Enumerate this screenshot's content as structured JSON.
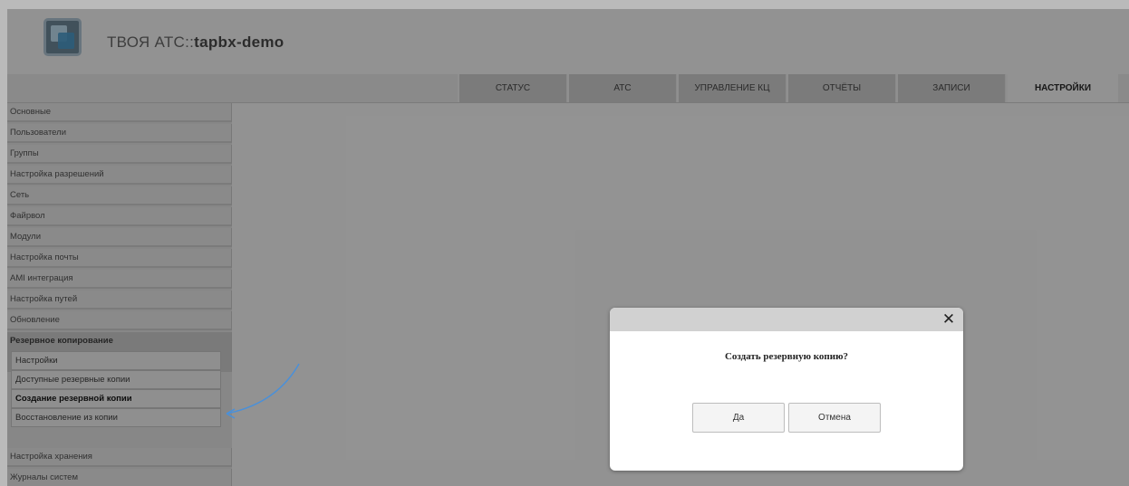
{
  "header": {
    "title_prefix": "ТВОЯ АТС::",
    "title_host": "tapbx-demo"
  },
  "topnav": {
    "tabs": [
      {
        "label": "СТАТУС"
      },
      {
        "label": "АТС"
      },
      {
        "label": "УПРАВЛЕНИЕ КЦ"
      },
      {
        "label": "ОТЧЁТЫ"
      },
      {
        "label": "ЗАПИСИ"
      },
      {
        "label": "НАСТРОЙКИ",
        "active": true
      }
    ]
  },
  "sidebar": {
    "items": [
      {
        "label": "Основные"
      },
      {
        "label": "Пользователи"
      },
      {
        "label": "Группы"
      },
      {
        "label": "Настройка разрешений"
      },
      {
        "label": "Сеть"
      },
      {
        "label": "Файрвол"
      },
      {
        "label": "Модули"
      },
      {
        "label": "Настройка почты"
      },
      {
        "label": "AMI интеграция"
      },
      {
        "label": "Настройка путей"
      },
      {
        "label": "Обновление"
      },
      {
        "label": "Резервное копирование",
        "active": true
      }
    ],
    "subitems": [
      {
        "label": "Настройки"
      },
      {
        "label": "Доступные резервные копии"
      },
      {
        "label": "Создание резервной копии",
        "current": true
      },
      {
        "label": "Восстановление из копии"
      }
    ],
    "items_after": [
      {
        "label": "Настройка хранения"
      },
      {
        "label": "Журналы систем"
      }
    ]
  },
  "dialog": {
    "message": "Создать резервную копию?",
    "yes_label": "Да",
    "cancel_label": "Отмена",
    "close_icon": "close-icon"
  },
  "colors": {
    "arrow": "#4a90d9",
    "overlay": "#000000"
  }
}
